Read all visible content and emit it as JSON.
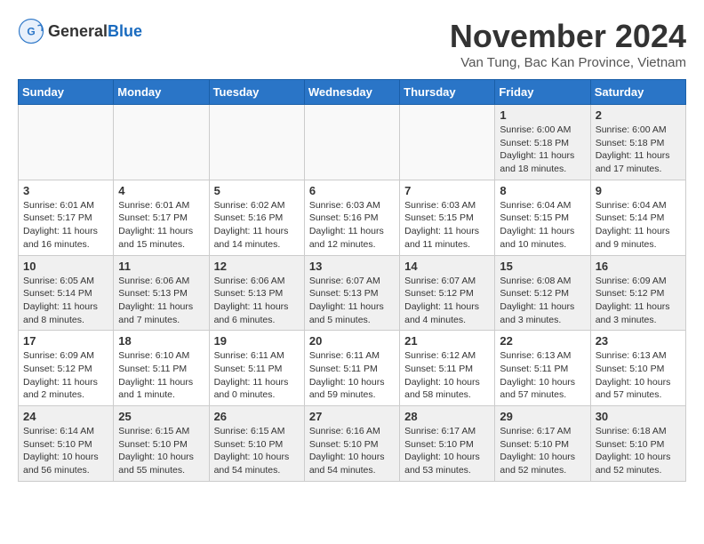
{
  "header": {
    "logo_general": "General",
    "logo_blue": "Blue",
    "month_title": "November 2024",
    "location": "Van Tung, Bac Kan Province, Vietnam"
  },
  "days_of_week": [
    "Sunday",
    "Monday",
    "Tuesday",
    "Wednesday",
    "Thursday",
    "Friday",
    "Saturday"
  ],
  "weeks": [
    [
      {
        "day": "",
        "detail": "",
        "empty": true
      },
      {
        "day": "",
        "detail": "",
        "empty": true
      },
      {
        "day": "",
        "detail": "",
        "empty": true
      },
      {
        "day": "",
        "detail": "",
        "empty": true
      },
      {
        "day": "",
        "detail": "",
        "empty": true
      },
      {
        "day": "1",
        "detail": "Sunrise: 6:00 AM\nSunset: 5:18 PM\nDaylight: 11 hours and 18 minutes."
      },
      {
        "day": "2",
        "detail": "Sunrise: 6:00 AM\nSunset: 5:18 PM\nDaylight: 11 hours and 17 minutes."
      }
    ],
    [
      {
        "day": "3",
        "detail": "Sunrise: 6:01 AM\nSunset: 5:17 PM\nDaylight: 11 hours and 16 minutes."
      },
      {
        "day": "4",
        "detail": "Sunrise: 6:01 AM\nSunset: 5:17 PM\nDaylight: 11 hours and 15 minutes."
      },
      {
        "day": "5",
        "detail": "Sunrise: 6:02 AM\nSunset: 5:16 PM\nDaylight: 11 hours and 14 minutes."
      },
      {
        "day": "6",
        "detail": "Sunrise: 6:03 AM\nSunset: 5:16 PM\nDaylight: 11 hours and 12 minutes."
      },
      {
        "day": "7",
        "detail": "Sunrise: 6:03 AM\nSunset: 5:15 PM\nDaylight: 11 hours and 11 minutes."
      },
      {
        "day": "8",
        "detail": "Sunrise: 6:04 AM\nSunset: 5:15 PM\nDaylight: 11 hours and 10 minutes."
      },
      {
        "day": "9",
        "detail": "Sunrise: 6:04 AM\nSunset: 5:14 PM\nDaylight: 11 hours and 9 minutes."
      }
    ],
    [
      {
        "day": "10",
        "detail": "Sunrise: 6:05 AM\nSunset: 5:14 PM\nDaylight: 11 hours and 8 minutes."
      },
      {
        "day": "11",
        "detail": "Sunrise: 6:06 AM\nSunset: 5:13 PM\nDaylight: 11 hours and 7 minutes."
      },
      {
        "day": "12",
        "detail": "Sunrise: 6:06 AM\nSunset: 5:13 PM\nDaylight: 11 hours and 6 minutes."
      },
      {
        "day": "13",
        "detail": "Sunrise: 6:07 AM\nSunset: 5:13 PM\nDaylight: 11 hours and 5 minutes."
      },
      {
        "day": "14",
        "detail": "Sunrise: 6:07 AM\nSunset: 5:12 PM\nDaylight: 11 hours and 4 minutes."
      },
      {
        "day": "15",
        "detail": "Sunrise: 6:08 AM\nSunset: 5:12 PM\nDaylight: 11 hours and 3 minutes."
      },
      {
        "day": "16",
        "detail": "Sunrise: 6:09 AM\nSunset: 5:12 PM\nDaylight: 11 hours and 3 minutes."
      }
    ],
    [
      {
        "day": "17",
        "detail": "Sunrise: 6:09 AM\nSunset: 5:12 PM\nDaylight: 11 hours and 2 minutes."
      },
      {
        "day": "18",
        "detail": "Sunrise: 6:10 AM\nSunset: 5:11 PM\nDaylight: 11 hours and 1 minute."
      },
      {
        "day": "19",
        "detail": "Sunrise: 6:11 AM\nSunset: 5:11 PM\nDaylight: 11 hours and 0 minutes."
      },
      {
        "day": "20",
        "detail": "Sunrise: 6:11 AM\nSunset: 5:11 PM\nDaylight: 10 hours and 59 minutes."
      },
      {
        "day": "21",
        "detail": "Sunrise: 6:12 AM\nSunset: 5:11 PM\nDaylight: 10 hours and 58 minutes."
      },
      {
        "day": "22",
        "detail": "Sunrise: 6:13 AM\nSunset: 5:11 PM\nDaylight: 10 hours and 57 minutes."
      },
      {
        "day": "23",
        "detail": "Sunrise: 6:13 AM\nSunset: 5:10 PM\nDaylight: 10 hours and 57 minutes."
      }
    ],
    [
      {
        "day": "24",
        "detail": "Sunrise: 6:14 AM\nSunset: 5:10 PM\nDaylight: 10 hours and 56 minutes."
      },
      {
        "day": "25",
        "detail": "Sunrise: 6:15 AM\nSunset: 5:10 PM\nDaylight: 10 hours and 55 minutes."
      },
      {
        "day": "26",
        "detail": "Sunrise: 6:15 AM\nSunset: 5:10 PM\nDaylight: 10 hours and 54 minutes."
      },
      {
        "day": "27",
        "detail": "Sunrise: 6:16 AM\nSunset: 5:10 PM\nDaylight: 10 hours and 54 minutes."
      },
      {
        "day": "28",
        "detail": "Sunrise: 6:17 AM\nSunset: 5:10 PM\nDaylight: 10 hours and 53 minutes."
      },
      {
        "day": "29",
        "detail": "Sunrise: 6:17 AM\nSunset: 5:10 PM\nDaylight: 10 hours and 52 minutes."
      },
      {
        "day": "30",
        "detail": "Sunrise: 6:18 AM\nSunset: 5:10 PM\nDaylight: 10 hours and 52 minutes."
      }
    ]
  ]
}
